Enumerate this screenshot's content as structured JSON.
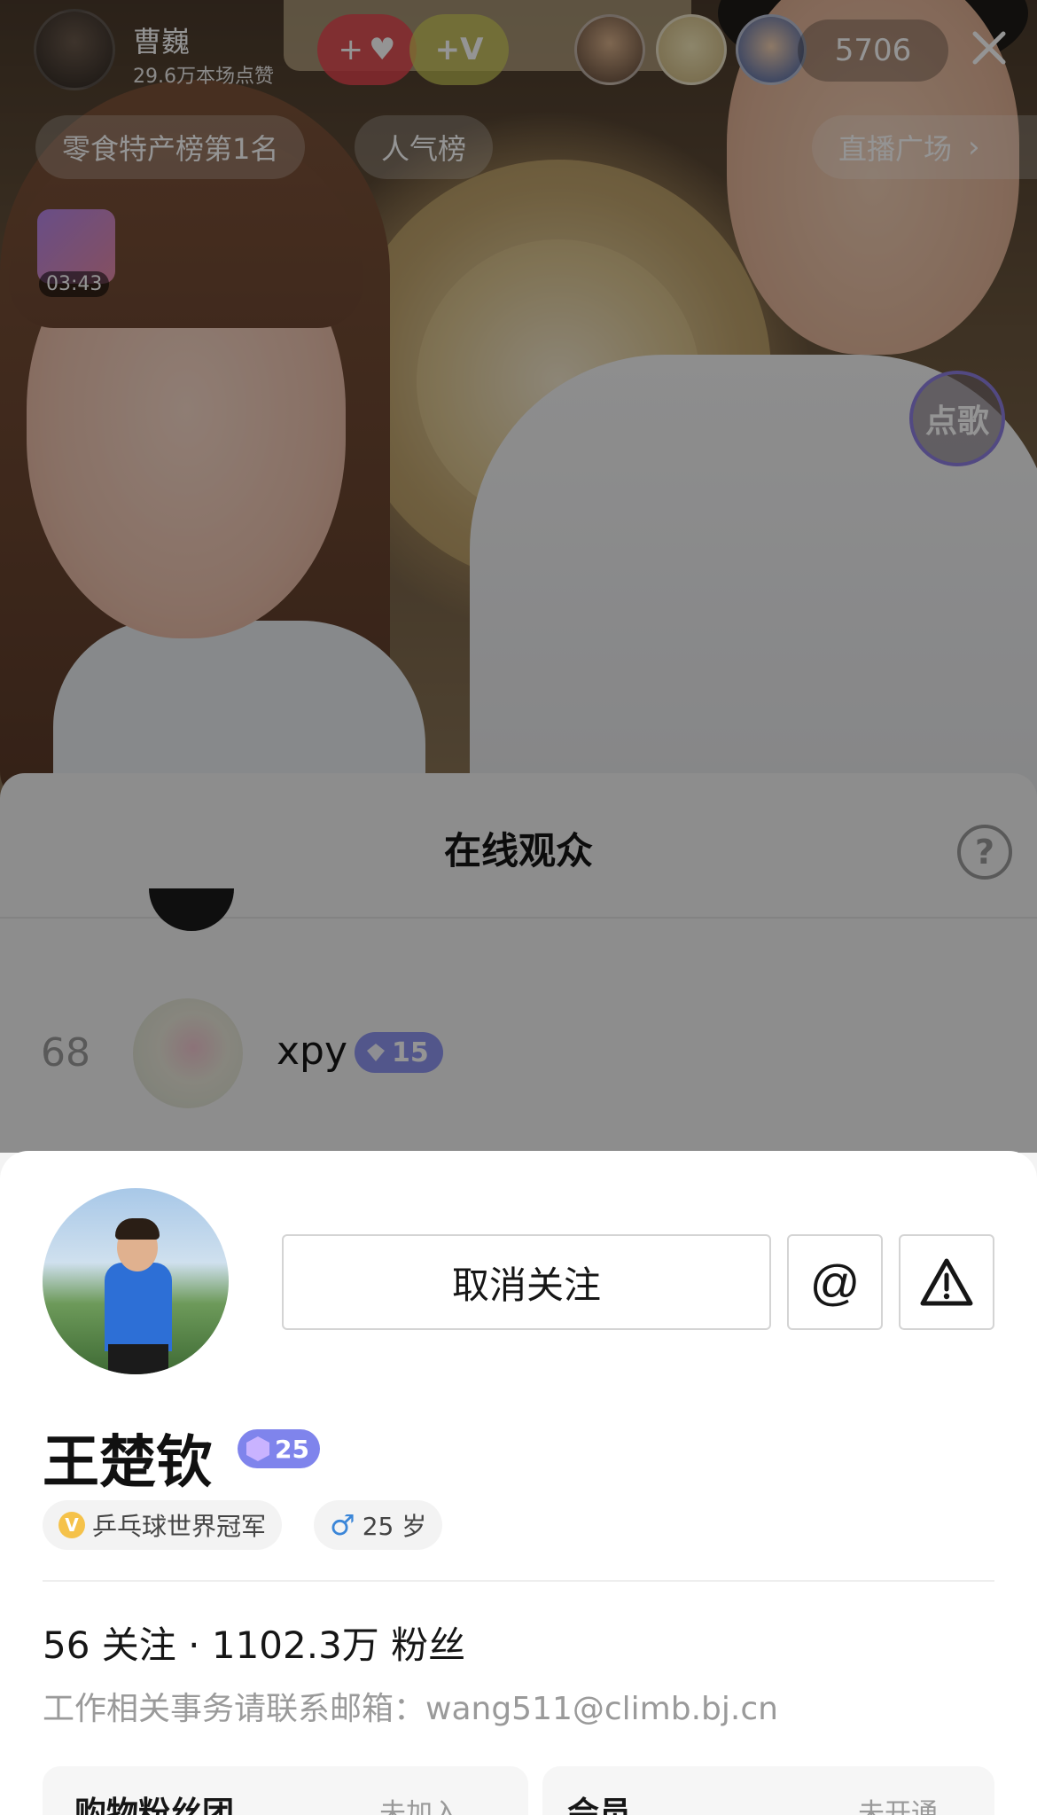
{
  "host": {
    "name": "曹巍",
    "likes": "29.6万本场点赞",
    "heart_label": "+",
    "vip_label": "+V"
  },
  "viewer_count": "5706",
  "tags": {
    "rank": "零食特产榜第1名",
    "popularity": "人气榜",
    "plaza": "直播广场"
  },
  "gift_timer": "03:43",
  "song_button": "点歌",
  "audience": {
    "title": "在线观众",
    "help": "?",
    "rows": [
      {
        "rank": "68",
        "name": "xpy",
        "level": "15"
      }
    ]
  },
  "profile": {
    "unfollow_label": "取消关注",
    "at_label": "@",
    "name": "王楚钦",
    "level": "25",
    "title_chip": "乒乓球世界冠军",
    "v_icon": "V",
    "gender_icon": "♂",
    "age": "25 岁",
    "stats": "56 关注 · 1102.3万 粉丝",
    "bio": "工作相关事务请联系邮箱：wang511@climb.bj.cn",
    "tiles": [
      {
        "title": "购物粉丝团",
        "status": "未加入"
      },
      {
        "title": "会员",
        "status": "未开通"
      }
    ]
  },
  "icons": {
    "close": "close-icon",
    "help": "help-icon",
    "report": "warning-icon",
    "chevron": "chevron-right-icon"
  },
  "colors": {
    "level_badge": "#7f84ec",
    "viewer_badge": "#8e95f0",
    "heart": "#e64650",
    "v_gold": "#f5c24a"
  }
}
